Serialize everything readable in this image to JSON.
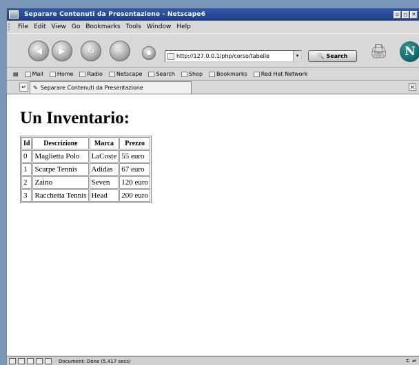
{
  "window": {
    "title": "Separare Contenuti da Presentazione - Netscape6",
    "controls": [
      "▫",
      "◻",
      "✕"
    ]
  },
  "menu": [
    "File",
    "Edit",
    "View",
    "Go",
    "Bookmarks",
    "Tools",
    "Window",
    "Help"
  ],
  "navigation": {
    "url": "http://127.0.0.1/php/corso/tabelle",
    "search_label": "Search"
  },
  "personal_toolbar": [
    "Mail",
    "Home",
    "Radio",
    "Netscape",
    "Search",
    "Shop",
    "Bookmarks",
    "Red Hat Network"
  ],
  "tab": {
    "label": "Separare Contenuti da Presentazione"
  },
  "page": {
    "heading": "Un Inventario:",
    "table": {
      "headers": [
        "Id",
        "Descrizione",
        "Marca",
        "Prezzo"
      ],
      "rows": [
        [
          "0",
          "Maglietta Polo",
          "LaCoste",
          "55 euro"
        ],
        [
          "1",
          "Scarpe Tennis",
          "Adidas",
          "67 euro"
        ],
        [
          "2",
          "Zaino",
          "Seven",
          "120 euro"
        ],
        [
          "3",
          "Racchetta Tennis",
          "Head",
          "200 euro"
        ]
      ]
    }
  },
  "status": {
    "text": "Document: Done (5.417 secs)"
  },
  "colors": {
    "desktop": "#7a96b8",
    "titlebar": "#2f5aa8",
    "chrome": "#d8d8d8"
  }
}
